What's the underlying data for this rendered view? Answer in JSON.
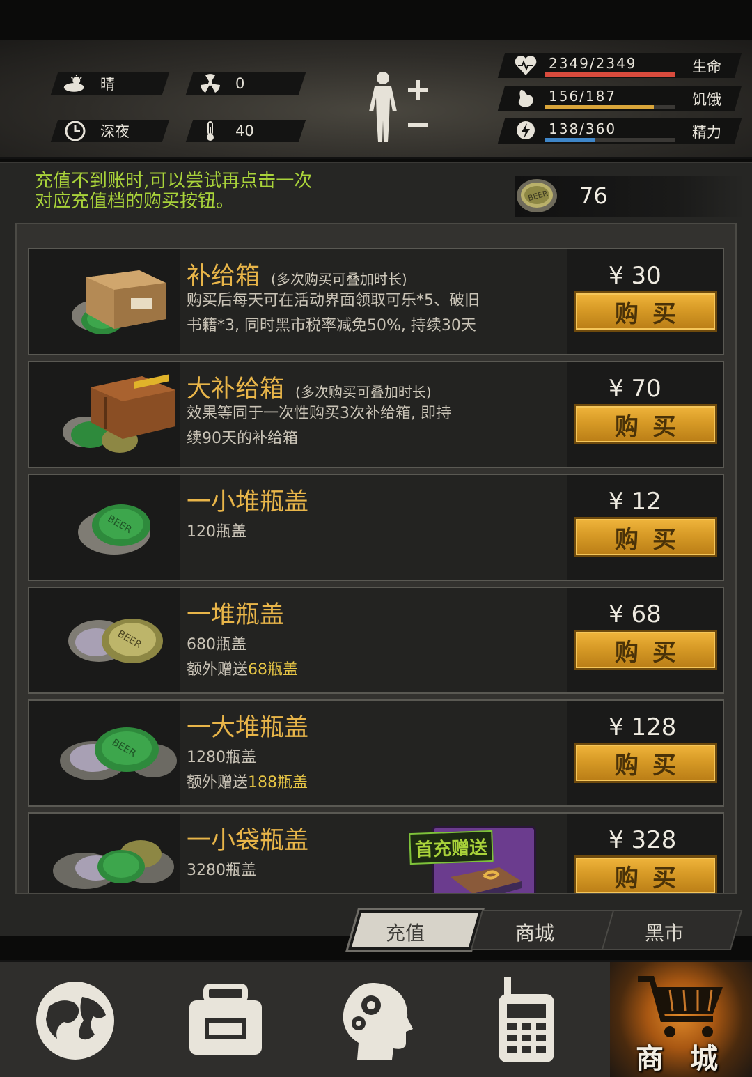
{
  "hud": {
    "weather": "晴",
    "radiation": "0",
    "time_of_day": "深夜",
    "temperature": "40",
    "stats": [
      {
        "value": "2349/2349",
        "label": "生命",
        "fill": 1.0,
        "color": "#d94b3d",
        "icon": "heart-icon"
      },
      {
        "value": "156/187",
        "label": "饥饿",
        "fill": 0.834,
        "color": "#d9a53a",
        "icon": "stomach-icon"
      },
      {
        "value": "138/360",
        "label": "精力",
        "fill": 0.383,
        "color": "#3f86c8",
        "icon": "energy-icon"
      }
    ]
  },
  "notice": {
    "line1": "充值不到账时,可以尝试再点击一次",
    "line2": "对应充值档的购买按钮。"
  },
  "currency": {
    "amount": "76",
    "icon": "bottle-cap-icon"
  },
  "products": [
    {
      "title": "补给箱",
      "note": "(多次购买可叠加时长)",
      "desc1": "购买后每天可在活动界面领取可乐*5、破旧",
      "desc2": "书籍*3, 同时黑市税率减免50%, 持续30天",
      "price": "¥ 30",
      "buy": "购买"
    },
    {
      "title": "大补给箱",
      "note": "(多次购买可叠加时长)",
      "desc1": "效果等同于一次性购买3次补给箱, 即持",
      "desc2": "续90天的补给箱",
      "price": "¥ 70",
      "buy": "购买"
    },
    {
      "title": "一小堆瓶盖",
      "desc1": "120瓶盖",
      "price": "¥ 12",
      "buy": "购买"
    },
    {
      "title": "一堆瓶盖",
      "desc1": "680瓶盖",
      "bonus_label": "额外赠送",
      "bonus_amount": "68瓶盖",
      "price": "¥ 68",
      "buy": "购买"
    },
    {
      "title": "一大堆瓶盖",
      "desc1": "1280瓶盖",
      "bonus_label": "额外赠送",
      "bonus_amount": "188瓶盖",
      "price": "¥ 128",
      "buy": "购买"
    },
    {
      "title": "一小袋瓶盖",
      "desc1": "3280瓶盖",
      "badge": "首充赠送",
      "price": "¥ 328",
      "buy": "购买"
    }
  ],
  "tabs": [
    {
      "label": "充值",
      "active": true
    },
    {
      "label": "商城",
      "active": false
    },
    {
      "label": "黑市",
      "active": false
    }
  ],
  "nav": {
    "items": [
      "globe-icon",
      "backpack-icon",
      "brain-icon",
      "radio-icon",
      "cart-icon"
    ],
    "shop_label": "商 城"
  },
  "colors": {
    "accent_green": "#a9d33a",
    "title_gold": "#e8b549",
    "button_orange": "#d79a26"
  }
}
